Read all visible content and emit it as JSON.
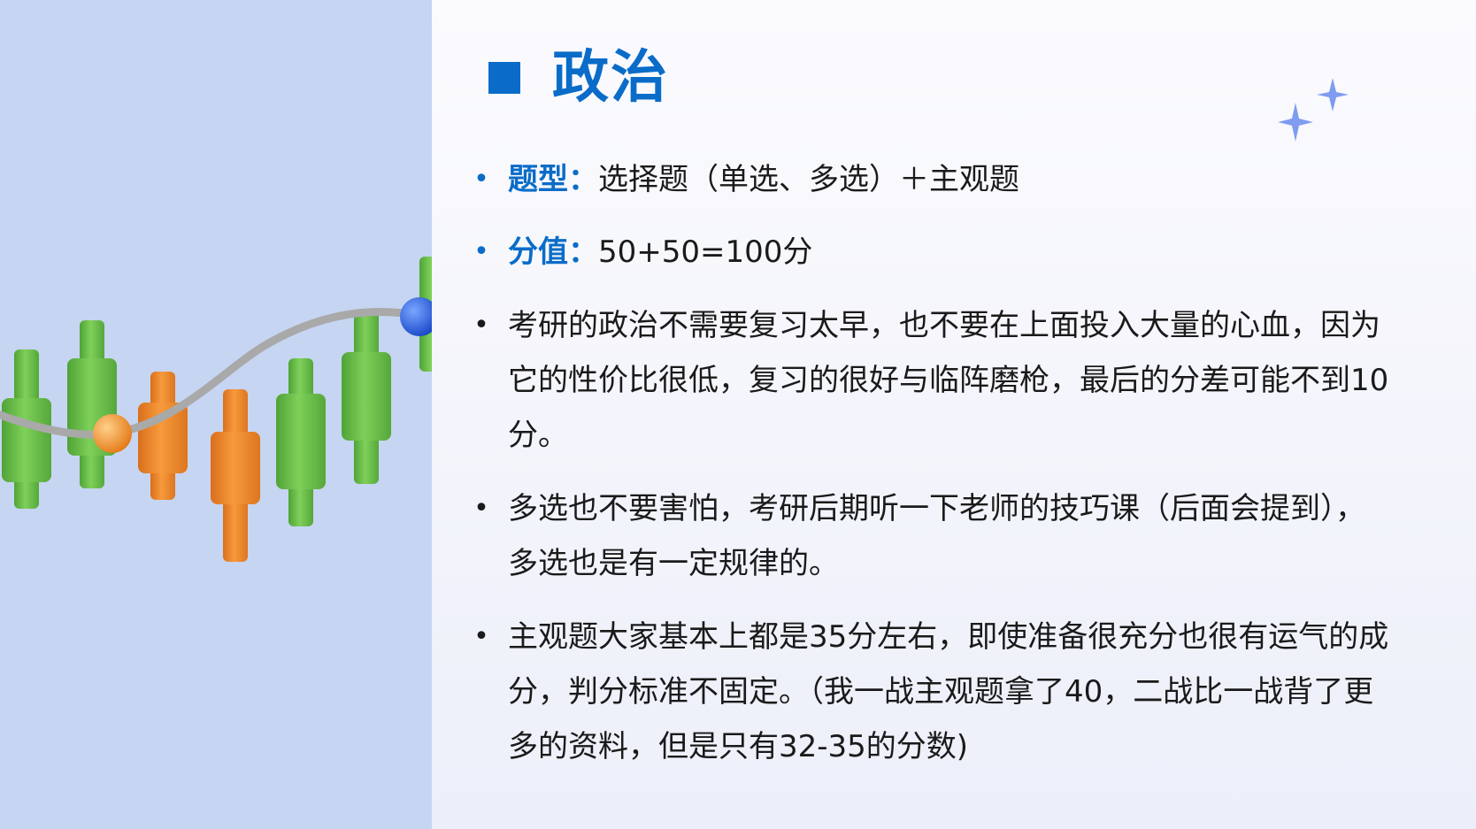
{
  "slide": {
    "title": "政治",
    "bullets": [
      {
        "label": "题型",
        "sep": "：",
        "text": "选择题（单选、多选）＋主观题"
      },
      {
        "label": "分值",
        "sep": "：",
        "text": "50+50=100分"
      },
      {
        "text": "考研的政治不需要复习太早，也不要在上面投入大量的心血，因为它的性价比很低，复习的很好与临阵磨枪，最后的分差可能不到10分。"
      },
      {
        "text": "多选也不要害怕，考研后期听一下老师的技巧课（后面会提到），多选也是有一定规律的。"
      },
      {
        "text": "主观题大家基本上都是35分左右，即使准备很充分也很有运气的成分，判分标准不固定。（我一战主观题拿了40，二战比一战背了更多的资料，但是只有32-35的分数)"
      }
    ]
  },
  "colors": {
    "accent": "#0a6cc8",
    "left_panel": "#c6d5f2",
    "candle_green": "#6cc04a",
    "candle_orange": "#ef8a2a",
    "sparkle": "#7f9cf0"
  },
  "icons": {
    "title_marker": "square-icon",
    "bullet": "bullet-dot-icon",
    "decoration": "sparkle-icon"
  }
}
